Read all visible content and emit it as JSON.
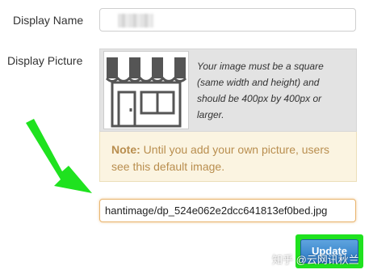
{
  "form": {
    "display_name_label": "Display Name",
    "display_picture_label": "Display Picture",
    "picture_hint": "Your image must be a square (same width and height) and should be 400px by 400px or larger.",
    "note_strong": "Note:",
    "note_text": "Until you add your own picture, users see this default image.",
    "image_path_value": "hantimage/dp_524e062e2dcc641813ef0bed.jpg",
    "update_label": "Update"
  },
  "icons": {
    "default_picture": "storefront-icon",
    "annotation": "arrow-icon"
  },
  "colors": {
    "highlight_green": "#1fe21f",
    "note_text": "#b98e4f",
    "note_background": "#fbf4e1",
    "button_blue": "#2a78c4"
  },
  "watermark": "知乎 @云网讯秋兰"
}
